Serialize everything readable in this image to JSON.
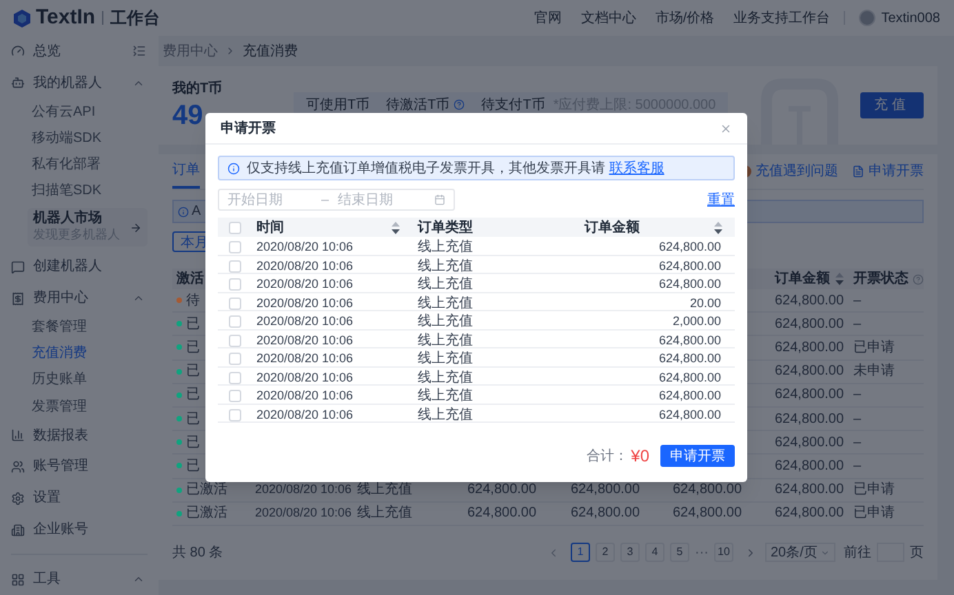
{
  "header": {
    "logo": "TextIn",
    "product": "工作台",
    "nav": [
      "官网",
      "文档中心",
      "市场/价格",
      "业务支持工作台"
    ],
    "user": "Textin008"
  },
  "sidebar": {
    "items": [
      {
        "kind": "item",
        "label": "总览"
      },
      {
        "kind": "group",
        "label": "我的机器人",
        "expanded": true,
        "children": [
          {
            "label": "公有云API",
            "selected": false
          },
          {
            "label": "移动端SDK",
            "selected": false
          },
          {
            "label": "私有化部署",
            "selected": false
          },
          {
            "label": "扫描笔SDK",
            "selected": false
          }
        ],
        "card": {
          "title": "机器人市场",
          "subtitle": "发现更多机器人"
        }
      },
      {
        "kind": "item",
        "label": "创建机器人"
      },
      {
        "kind": "group",
        "label": "费用中心",
        "expanded": true,
        "children": [
          {
            "label": "套餐管理",
            "selected": false
          },
          {
            "label": "充值消费",
            "selected": true
          },
          {
            "label": "历史账单",
            "selected": false
          },
          {
            "label": "发票管理",
            "selected": false
          }
        ]
      },
      {
        "kind": "item",
        "label": "数据报表"
      },
      {
        "kind": "item",
        "label": "账号管理"
      },
      {
        "kind": "item",
        "label": "设置"
      },
      {
        "kind": "item",
        "label": "企业账号"
      },
      {
        "kind": "group",
        "label": "工具",
        "expanded": true
      }
    ]
  },
  "breadcrumb": [
    "费用中心",
    "充值消费"
  ],
  "balance": {
    "title": "我的T币",
    "amount": "49",
    "stats": [
      {
        "label": "可使用T币",
        "help": false
      },
      {
        "label": "待激活T币",
        "help": true
      },
      {
        "label": "待支付T币",
        "help": false,
        "note": "*应付费上限: 5000000.000"
      }
    ],
    "button": "充值"
  },
  "orders": {
    "tabs": [
      {
        "label": "订单",
        "selected": true
      }
    ],
    "links": [
      {
        "kind": "help",
        "label": "充值遇到问题"
      },
      {
        "kind": "invoice",
        "label": "申请开票"
      }
    ],
    "alert": "A",
    "filter": {
      "label": "本月",
      "selected": true
    },
    "columns": [
      {
        "label": "激活"
      },
      {
        "label": "订单金额",
        "sortable": true
      },
      {
        "label": "开票状态",
        "help": true
      }
    ],
    "rows": [
      {
        "status": "待",
        "color": "#a55a34",
        "amount": "624,800.00",
        "invoice": "–"
      },
      {
        "status": "已",
        "color": "#10a37f",
        "amount": "624,800.00",
        "invoice": "–"
      },
      {
        "status": "已",
        "color": "#10a37f",
        "amount": "624,800.00",
        "invoice": "已申请"
      },
      {
        "status": "已",
        "color": "#10a37f",
        "amount": "624,800.00",
        "invoice": "未申请"
      },
      {
        "status": "已",
        "color": "#10a37f",
        "amount": "624,800.00",
        "invoice": "–"
      },
      {
        "status": "已",
        "color": "#10a37f",
        "amount": "624,800.00",
        "invoice": "–"
      },
      {
        "status": "已",
        "color": "#10a37f",
        "amount": "624,800.00",
        "invoice": "–"
      },
      {
        "status": "已",
        "color": "#10a37f",
        "amount": "624,800.00",
        "invoice": "–"
      },
      {
        "status": "已激活",
        "color": "#10a37f",
        "middle": [
          "2020/08/20 10:06",
          "线上充值",
          "624,800.00",
          "624,800.00",
          "624,800.00"
        ],
        "amount": "624,800.00",
        "invoice": "已申请"
      },
      {
        "status": "已激活",
        "color": "#10a37f",
        "middle": [
          "2020/08/20 10:06",
          "线上充值",
          "624,800.00",
          "624,800.00",
          "624,800.00"
        ],
        "amount": "624,800.00",
        "invoice": "已申请"
      }
    ],
    "pagination": {
      "total": "共 80 条",
      "pages": [
        {
          "kind": "page",
          "label": "1",
          "selected": true
        },
        {
          "kind": "page",
          "label": "2",
          "selected": false
        },
        {
          "kind": "page",
          "label": "3",
          "selected": false
        },
        {
          "kind": "page",
          "label": "4",
          "selected": false
        },
        {
          "kind": "page",
          "label": "5",
          "selected": false
        },
        {
          "kind": "ellipsis",
          "label": "···",
          "selected": false
        },
        {
          "kind": "page",
          "label": "10",
          "selected": false
        }
      ],
      "page_size": "20条/页",
      "goto": "前往",
      "goto_suffix": "页"
    }
  },
  "modal": {
    "title": "申请开票",
    "alert": "仅支持线上充值订单增值税电子发票开具，其他发票开具请",
    "alert_link": "联系客服",
    "start_placeholder": "开始日期",
    "range_separator": "–",
    "end_placeholder": "结束日期",
    "reset": "重置",
    "select_all": {
      "checked": false
    },
    "columns": [
      {
        "label": "时间",
        "sortable": true
      },
      {
        "label": "订单类型",
        "sortable": false
      },
      {
        "label": "订单金额",
        "sortable": true
      }
    ],
    "rows": [
      {
        "time": "2020/08/20 10:06",
        "type": "线上充值",
        "amount": "624,800.00",
        "checked": false
      },
      {
        "time": "2020/08/20 10:06",
        "type": "线上充值",
        "amount": "624,800.00",
        "checked": false
      },
      {
        "time": "2020/08/20 10:06",
        "type": "线上充值",
        "amount": "624,800.00",
        "checked": false
      },
      {
        "time": "2020/08/20 10:06",
        "type": "线上充值",
        "amount": "20.00",
        "checked": false
      },
      {
        "time": "2020/08/20 10:06",
        "type": "线上充值",
        "amount": "2,000.00",
        "checked": false
      },
      {
        "time": "2020/08/20 10:06",
        "type": "线上充值",
        "amount": "624,800.00",
        "checked": false
      },
      {
        "time": "2020/08/20 10:06",
        "type": "线上充值",
        "amount": "624,800.00",
        "checked": false
      },
      {
        "time": "2020/08/20 10:06",
        "type": "线上充值",
        "amount": "624,800.00",
        "checked": false
      },
      {
        "time": "2020/08/20 10:06",
        "type": "线上充值",
        "amount": "624,800.00",
        "checked": false
      },
      {
        "time": "2020/08/20 10:06",
        "type": "线上充值",
        "amount": "624,800.00",
        "checked": false
      }
    ],
    "total_label": "合计：",
    "total": "¥0",
    "submit": "申请开票"
  }
}
